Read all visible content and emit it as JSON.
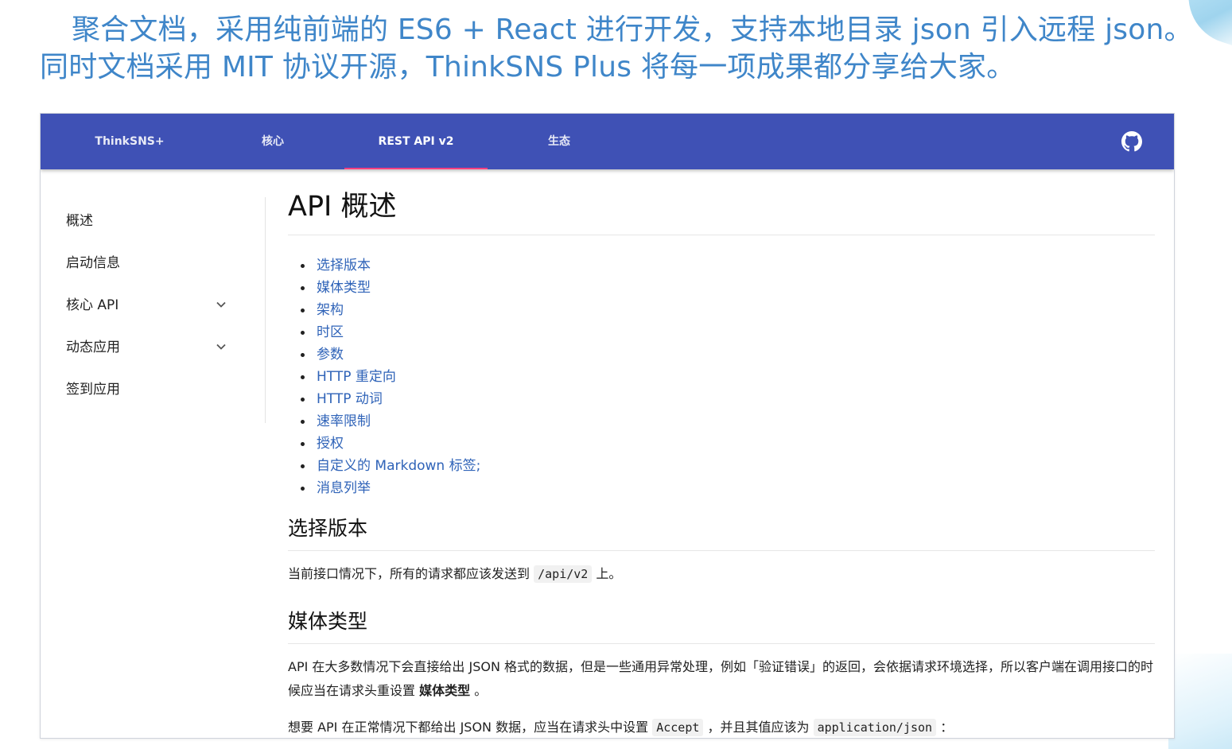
{
  "caption": {
    "line1": "聚合文档，采用纯前端的 ES6 + React 进行开发，支持本地目录 json 引入远程 json。",
    "line2": "同时文档采用 MIT 协议开源，ThinkSNS Plus 将每一项成果都分享给大家。"
  },
  "colors": {
    "primary": "#3f51b5",
    "accent": "#ff4081",
    "link": "#2f63b8",
    "caption": "#3f86c9"
  },
  "nav": {
    "items": [
      {
        "label": "ThinkSNS+"
      },
      {
        "label": "核心"
      },
      {
        "label": "REST API v2",
        "active": true
      },
      {
        "label": "生态"
      }
    ],
    "github_icon": "github-icon"
  },
  "sidebar": {
    "items": [
      {
        "label": "概述"
      },
      {
        "label": "启动信息"
      },
      {
        "label": "核心 API",
        "expandable": true
      },
      {
        "label": "动态应用",
        "expandable": true
      },
      {
        "label": "签到应用"
      }
    ]
  },
  "content": {
    "title": "API 概述",
    "toc": [
      "选择版本",
      "媒体类型",
      "架构",
      "时区",
      "参数",
      "HTTP 重定向",
      "HTTP 动词",
      "速率限制",
      "授权",
      "自定义的 Markdown 标签;",
      "消息列举"
    ],
    "sections": {
      "version": {
        "title": "选择版本",
        "text_before": "当前接口情况下，所有的请求都应该发送到",
        "code": "/api/v2",
        "text_after": "上。"
      },
      "media": {
        "title": "媒体类型",
        "p1_text": "API 在大多数情况下会直接给出 JSON 格式的数据，但是一些通用异常处理，例如「验证错误」的返回，会依据请求环境选择，所以客户端在调用接口的时候应当在请求头重设置",
        "p1_strong": "媒体类型",
        "p1_end": "。",
        "p2_a": "想要 API 在正常情况下都给出 JSON 数据，应当在请求头中设置",
        "p2_code1": "Accept",
        "p2_b": "，并且其值应该为",
        "p2_code2": "application/json",
        "p2_c": "："
      }
    }
  }
}
